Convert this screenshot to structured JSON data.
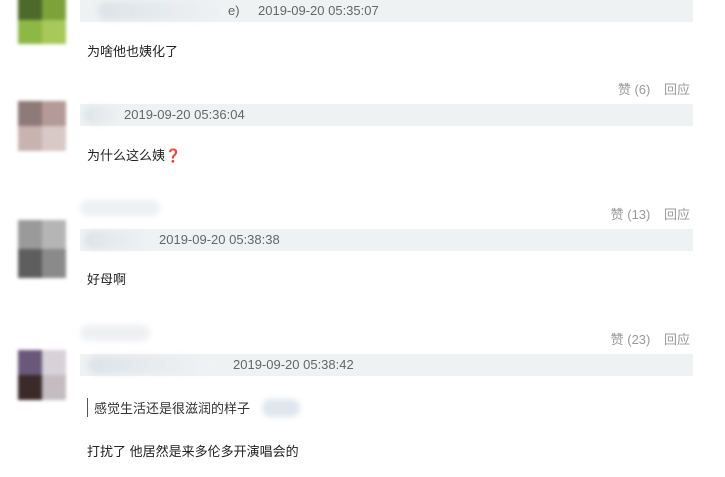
{
  "comments": [
    {
      "name_suffix": "e)",
      "time": "2019-09-20 05:35:07",
      "text": "为啥他也姨化了",
      "actions": {
        "like": "赞 (6)",
        "reply": "回应"
      }
    },
    {
      "name_suffix": "",
      "time": "2019-09-20 05:36:04",
      "text": "为什么这么姨",
      "emoji": "❓",
      "actions": {
        "like": "赞 (13)",
        "reply": "回应"
      }
    },
    {
      "name_suffix": "",
      "time": "2019-09-20 05:38:38",
      "text": "好母啊",
      "actions": {
        "like": "赞 (23)",
        "reply": "回应"
      }
    },
    {
      "name_suffix": "",
      "time": "2019-09-20 05:38:42",
      "quote": "感觉生活还是很滋润的样子",
      "text": "打扰了 他居然是来多伦多开演唱会的"
    }
  ],
  "colors": {
    "meta_bar": "#eef2f3",
    "action_text": "#999999",
    "emoji_red": "#c0392b"
  }
}
